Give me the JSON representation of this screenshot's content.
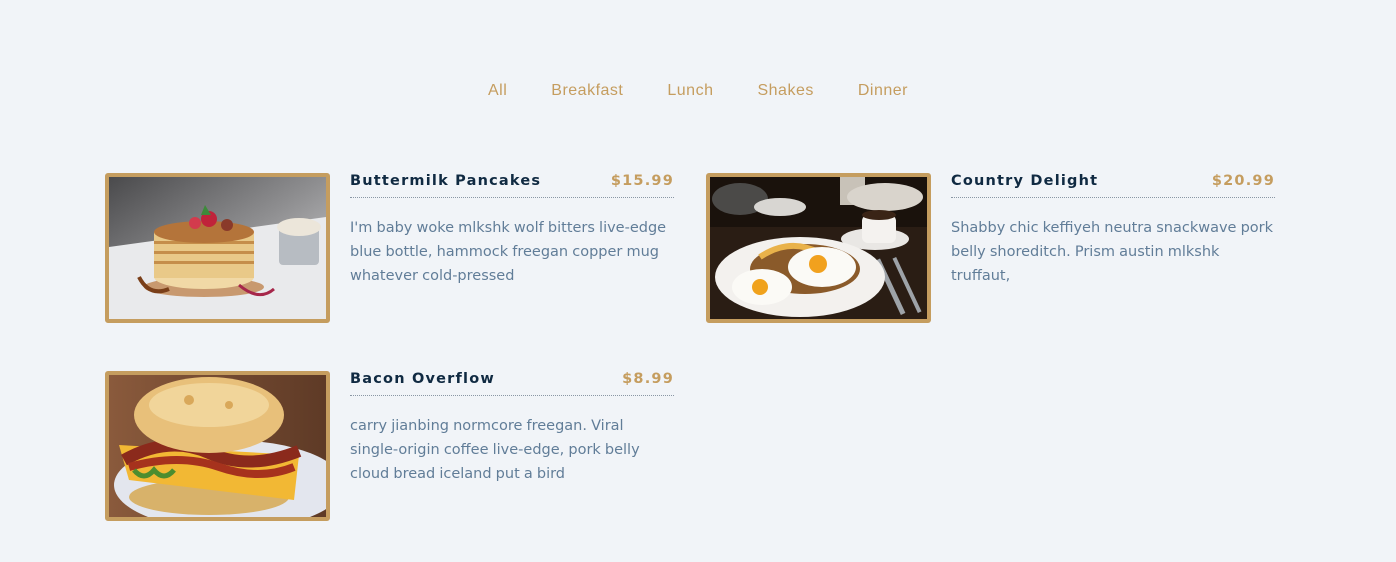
{
  "filters": [
    "All",
    "Breakfast",
    "Lunch",
    "Shakes",
    "Dinner"
  ],
  "accent_color": "#c59d5f",
  "items": [
    {
      "title": "Buttermilk Pancakes",
      "price": "$15.99",
      "desc": "I'm baby woke mlkshk wolf bitters live-edge blue bottle, hammock freegan copper mug whatever cold-pressed",
      "image": "pancakes-photo"
    },
    {
      "title": "Country Delight",
      "price": "$20.99",
      "desc": "Shabby chic keffiyeh neutra snackwave pork belly shoreditch. Prism austin mlkshk truffaut,",
      "image": "eggs-photo"
    },
    {
      "title": "Bacon Overflow",
      "price": "$8.99",
      "desc": "carry jianbing normcore freegan. Viral single-origin coffee live-edge, pork belly cloud bread iceland put a bird",
      "image": "sandwich-photo"
    }
  ]
}
